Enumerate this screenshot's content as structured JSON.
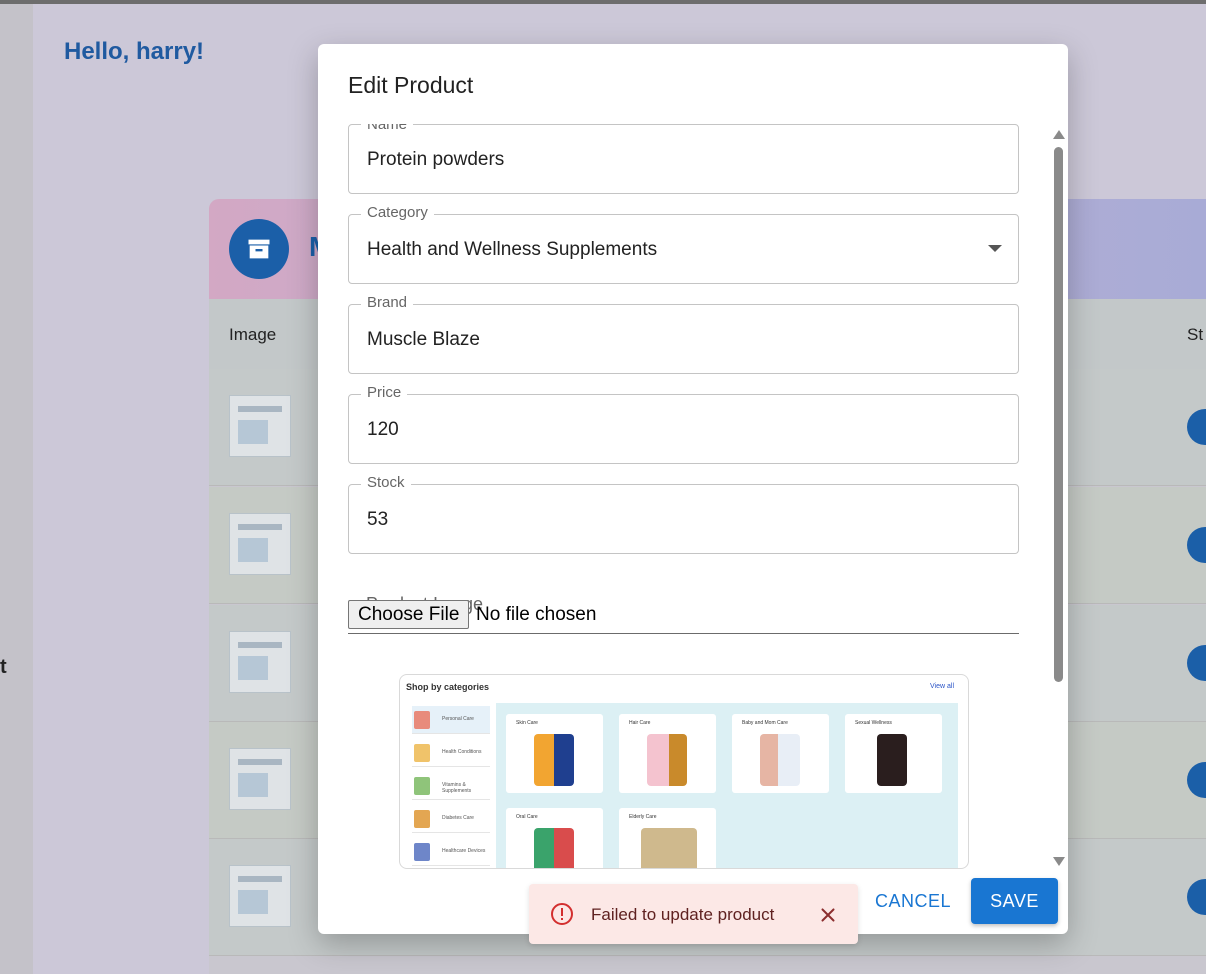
{
  "background": {
    "greeting": "Hello, harry!",
    "rail_fragment": "t",
    "card_title_fragment": "M",
    "columns": {
      "image": "Image",
      "status_fragment": "St"
    }
  },
  "dialog": {
    "title": "Edit Product",
    "fields": {
      "name": {
        "label": "Name",
        "value": "Protein powders"
      },
      "category": {
        "label": "Category",
        "value": "Health and Wellness Supplements"
      },
      "brand": {
        "label": "Brand",
        "value": "Muscle Blaze"
      },
      "price": {
        "label": "Price",
        "value": "120"
      },
      "stock": {
        "label": "Stock",
        "value": "53"
      }
    },
    "image_field": {
      "label": "Product Image",
      "button": "Choose File",
      "status": "No file chosen"
    },
    "preview": {
      "heading": "Shop by categories",
      "view_all": "View all",
      "side_items": [
        "Personal Care",
        "Health Conditions",
        "Vitamins & Supplements",
        "Diabetes Care",
        "Healthcare Devices"
      ],
      "tiles": [
        "Skin Care",
        "Hair Care",
        "Baby and Mom Care",
        "Sexual Wellness",
        "Oral Care",
        "Elderly Care"
      ]
    },
    "actions": {
      "cancel": "CANCEL",
      "save": "SAVE"
    },
    "colors": {
      "primary": "#1976d2",
      "error": "#d32f2f"
    }
  },
  "toast": {
    "message": "Failed to update product",
    "severity": "error"
  }
}
